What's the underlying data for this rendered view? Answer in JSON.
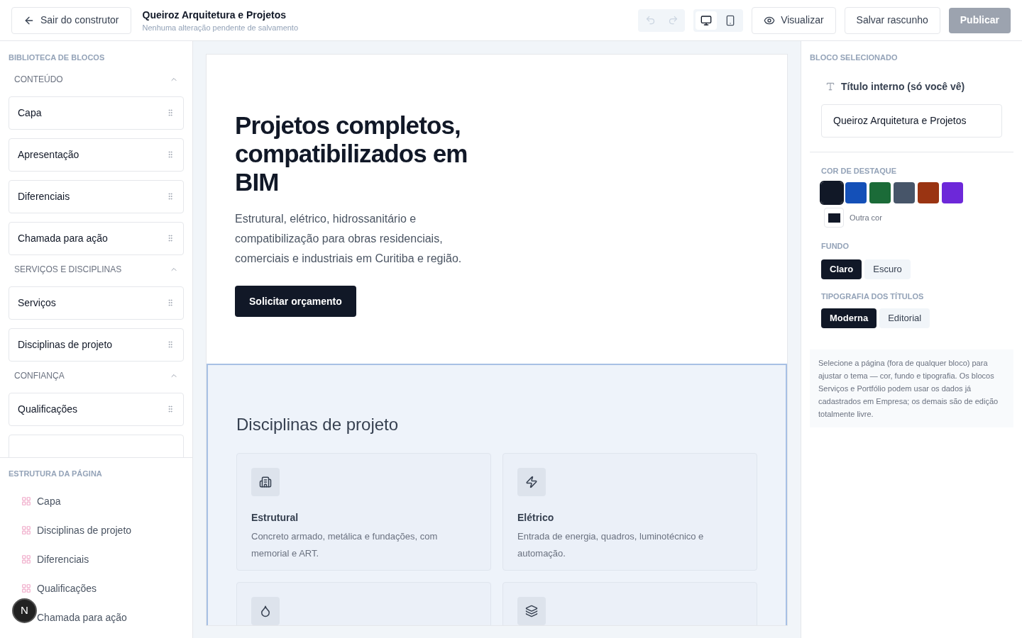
{
  "header": {
    "exit_button": "Sair do construtor",
    "site_title": "Queiroz Arquitetura e Projetos",
    "save_status": "Nenhuma alteração pendente de salvamento",
    "history": [
      {
        "kind": "undo",
        "disabled": true
      },
      {
        "kind": "redo",
        "disabled": true
      }
    ],
    "devices": [
      {
        "kind": "desktop",
        "selected": true
      },
      {
        "kind": "mobile",
        "selected": false
      }
    ],
    "preview_button": "Visualizar",
    "draft_button": "Salvar rascunho",
    "publish_button": {
      "label": "Publicar",
      "disabled": true
    }
  },
  "library": {
    "title": "BIBLIOTECA DE BLOCOS",
    "sections": [
      {
        "title": "CONTEÚDO",
        "expanded": true,
        "items": [
          {
            "label": "Capa"
          },
          {
            "label": "Apresentação"
          },
          {
            "label": "Diferenciais"
          },
          {
            "label": "Chamada para ação"
          }
        ]
      },
      {
        "title": "SERVIÇOS E DISCIPLINAS",
        "expanded": true,
        "items": [
          {
            "label": "Serviços"
          },
          {
            "label": "Disciplinas de projeto"
          }
        ]
      },
      {
        "title": "CONFIANÇA",
        "expanded": true,
        "more_below": true,
        "items": [
          {
            "label": "Qualificações"
          }
        ]
      }
    ]
  },
  "structure": {
    "title": "ESTRUTURA DA PÁGINA",
    "items": [
      "Capa",
      "Disciplinas de projeto",
      "Diferenciais",
      "Qualificações",
      "Chamada para ação"
    ]
  },
  "dev_badge": "N",
  "canvas": {
    "hero": {
      "heading": "Projetos completos, compatibilizados em BIM",
      "text": "Estrutural, elétrico, hidrossanitário e compatibilização para obras residenciais, comerciais e industriais em Curitiba e região.",
      "button": "Solicitar orçamento"
    },
    "disciplines": {
      "selected": true,
      "heading": "Disciplinas de projeto",
      "cards": [
        {
          "kind": "building",
          "title": "Estrutural",
          "text": "Concreto armado, metálica e fundações, com memorial e ART."
        },
        {
          "kind": "bolt",
          "title": "Elétrico",
          "text": "Entrada de energia, quadros, luminotécnico e automação."
        },
        {
          "kind": "drop"
        },
        {
          "kind": "layers"
        }
      ]
    }
  },
  "inspector": {
    "title": "BLOCO SELECIONADO",
    "field_label": "Título interno (só você vê)",
    "field_value": "Queiroz Arquitetura e Projetos",
    "accent": {
      "title": "COR DE DESTAQUE",
      "swatches": [
        {
          "color": "#111827",
          "selected": true
        },
        {
          "color": "#1450b8",
          "selected": false
        },
        {
          "color": "#1b6b38",
          "selected": false
        },
        {
          "color": "#475569",
          "selected": false
        },
        {
          "color": "#9a3412",
          "selected": false
        },
        {
          "color": "#6d28d9",
          "selected": false
        }
      ],
      "custom": {
        "label": "Outra cor",
        "color": "#111827"
      }
    },
    "background": {
      "title": "FUNDO",
      "options": [
        {
          "label": "Claro",
          "selected": true
        },
        {
          "label": "Escuro",
          "selected": false
        }
      ]
    },
    "typography": {
      "title": "TIPOGRAFIA DOS TÍTULOS",
      "options": [
        {
          "label": "Moderna",
          "selected": true
        },
        {
          "label": "Editorial",
          "selected": false
        }
      ]
    },
    "help": "Selecione a página (fora de qualquer bloco) para ajustar o tema — cor, fundo e tipografia. Os blocos Serviços e Portfólio podem usar os dados já cadastrados em Empresa; os demais são de edição totalmente livre."
  }
}
